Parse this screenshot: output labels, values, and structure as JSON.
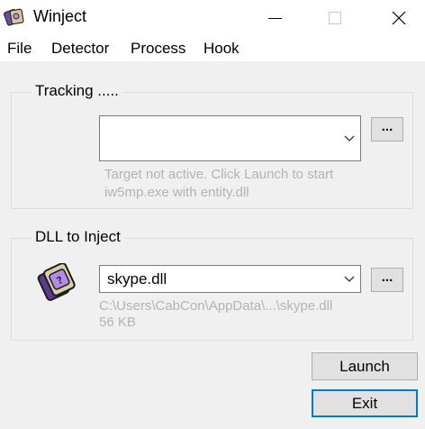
{
  "window": {
    "title": "Winject"
  },
  "menu": {
    "items": [
      "File",
      "Detector",
      "Process",
      "Hook"
    ]
  },
  "tracking": {
    "group_label": "Tracking .....",
    "combo_value": "",
    "browse_label": "...",
    "hint_line1": "Target not active. Click Launch to start",
    "hint_line2": "iw5mp.exe with entity.dll"
  },
  "dll": {
    "group_label": "DLL to Inject",
    "combo_value": "skype.dll",
    "browse_label": "...",
    "path": "C:\\Users\\CabCon\\AppData\\...\\skype.dll",
    "size": "56 KB"
  },
  "buttons": {
    "launch": "Launch",
    "exit": "Exit"
  },
  "icons": {
    "app": "syringe-dll-icon",
    "dll": "dll-file-icon",
    "minimize": "minimize-icon",
    "maximize": "maximize-icon",
    "close": "close-icon",
    "dropdown": "chevron-down-icon"
  }
}
